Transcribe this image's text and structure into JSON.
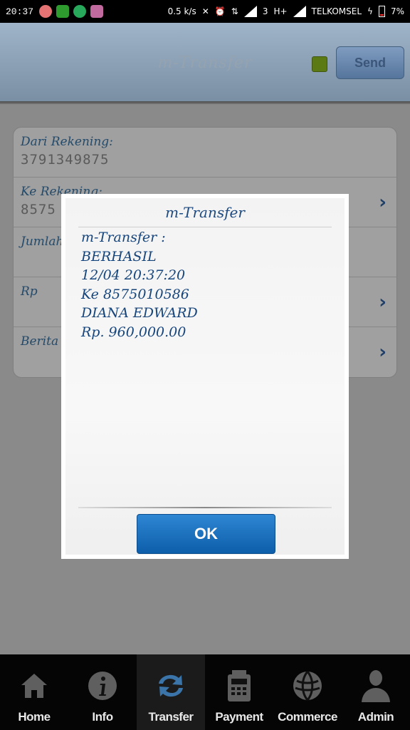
{
  "status_bar": {
    "time": "20:37",
    "speed": "0.5 k/s",
    "net_sim": "3",
    "net_type": "H+",
    "carrier": "TELKOMSEL",
    "battery": "7%"
  },
  "app": {
    "title": "m-Transfer",
    "send_label": "Send"
  },
  "form": {
    "rows": [
      {
        "label": "Dari Rekening:",
        "value": "3791349875"
      },
      {
        "label": "Ke Rekening:",
        "value": "8575"
      },
      {
        "label": "Jumlah",
        "value": ""
      },
      {
        "label": "Rp",
        "value": ""
      },
      {
        "label": "Berita",
        "value": ""
      }
    ]
  },
  "dialog": {
    "title": "m-Transfer",
    "lines": [
      "m-Transfer :",
      "BERHASIL",
      "12/04 20:37:20",
      "Ke 8575010586",
      "DIANA EDWARD",
      "Rp. 960,000.00"
    ],
    "ok_label": "OK"
  },
  "tabs": [
    {
      "label": "Home",
      "icon": "home-icon"
    },
    {
      "label": "Info",
      "icon": "info-icon"
    },
    {
      "label": "Transfer",
      "icon": "transfer-icon"
    },
    {
      "label": "Payment",
      "icon": "payment-icon"
    },
    {
      "label": "Commerce",
      "icon": "commerce-icon"
    },
    {
      "label": "Admin",
      "icon": "admin-icon"
    }
  ],
  "colors": {
    "accent": "#0d5eaa",
    "dialog_text": "#16457c"
  }
}
